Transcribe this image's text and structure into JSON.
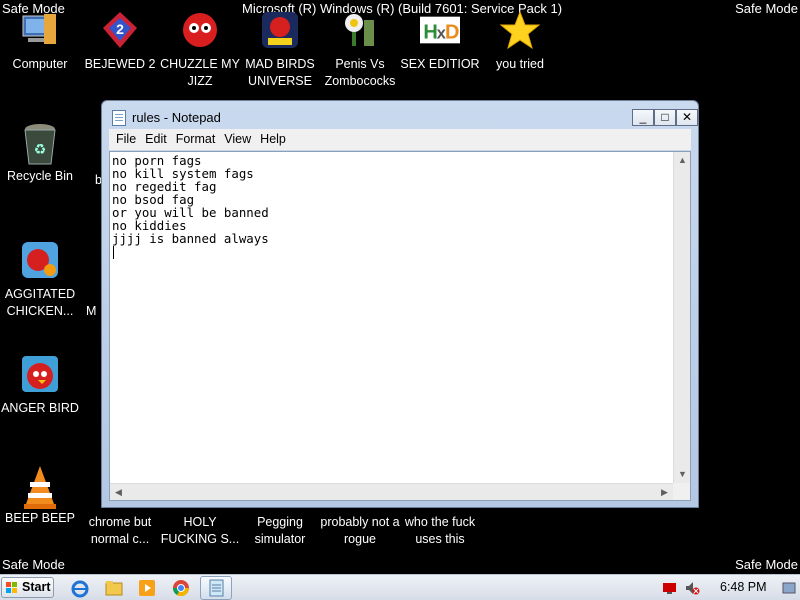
{
  "watermark": {
    "safe_mode": "Safe Mode",
    "build": "Microsoft (R) Windows (R) (Build 7601: Service Pack 1)"
  },
  "desktop_icons": [
    {
      "label": "Computer",
      "icon": "computer-icon"
    },
    {
      "label": "BEJEWED 2",
      "icon": "bejeweled-icon"
    },
    {
      "label": "CHUZZLE MY JIZZ",
      "icon": "chuzzle-icon"
    },
    {
      "label": "MAD BIRDS UNIVERSE",
      "icon": "angry-birds-space-icon"
    },
    {
      "label": "Penis Vs Zombococks",
      "icon": "plants-vs-zombies-icon"
    },
    {
      "label": "SEX EDITIOR",
      "icon": "hxd-editor-icon"
    },
    {
      "label": "you tried",
      "icon": "star-icon"
    },
    {
      "label": "Recycle Bin",
      "icon": "recycle-bin-icon"
    },
    {
      "label": "b",
      "icon": "partial-icon"
    },
    {
      "label": "AGGITATED CHICKEN...",
      "icon": "angry-birds-rio-icon"
    },
    {
      "label": "M",
      "icon": "partial-icon"
    },
    {
      "label": "ANGER BIRD",
      "icon": "angry-bird-icon"
    },
    {
      "label": "BEEP BEEP",
      "icon": "vlc-cone-icon"
    },
    {
      "label": "chrome but normal c...",
      "icon": "chrome-icon"
    },
    {
      "label": "HOLY FUCKING S...",
      "icon": "app-icon"
    },
    {
      "label": "Pegging simulator",
      "icon": "app-icon"
    },
    {
      "label": "probably not a rogue",
      "icon": "app-icon"
    },
    {
      "label": "who the fuck uses this",
      "icon": "app-icon"
    }
  ],
  "notepad": {
    "title": "rules - Notepad",
    "buttons": {
      "minimize": "_",
      "maximize": "□",
      "close": "✕"
    },
    "menu": [
      "File",
      "Edit",
      "Format",
      "View",
      "Help"
    ],
    "content": "no porn fags\nno kill system fags\nno regedit fag\nno bsod fag\nor you will be banned\nno kiddies\njjjj is banned always"
  },
  "taskbar": {
    "start_label": "Start",
    "clock": "6:48 PM",
    "pinned": [
      "internet-explorer-icon",
      "folder-icon",
      "media-player-icon",
      "chrome-icon",
      "notepad-icon"
    ]
  }
}
